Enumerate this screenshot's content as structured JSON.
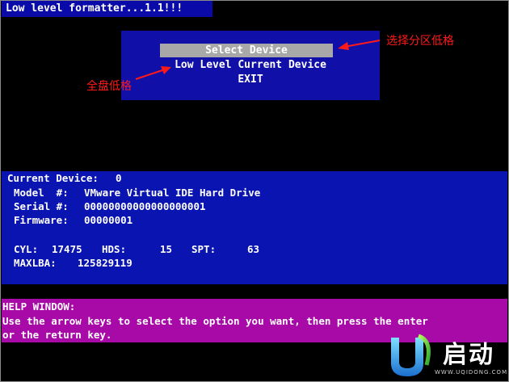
{
  "title": "Low level formatter...1.1!!!",
  "menu": {
    "items": [
      {
        "label": "Select Device",
        "selected": true
      },
      {
        "label": "Low Level Current Device",
        "selected": false
      },
      {
        "label": "EXIT",
        "selected": false
      }
    ]
  },
  "annotations": {
    "partition_format": "选择分区低格",
    "full_disk_format": "全盘低格",
    "color": "#ff1a1a"
  },
  "device": {
    "current_device_label": "Current Device:",
    "current_device_value": "0",
    "model_label": "Model  #:",
    "model_value": "VMware Virtual IDE Hard Drive",
    "serial_label": "Serial #:",
    "serial_value": "00000000000000000001",
    "firmware_label": "Firmware:",
    "firmware_value": "00000001",
    "cyl_label": "CYL:",
    "cyl_value": "17475",
    "hds_label": "HDS:",
    "hds_value": "15",
    "spt_label": "SPT:",
    "spt_value": "63",
    "maxlba_label": "MAXLBA:",
    "maxlba_value": "125829119"
  },
  "help": {
    "title": "HELP WINDOW:",
    "line1": "Use the arrow keys to select the option you want, then press the enter",
    "line2": "or the return key."
  },
  "logo": {
    "text": "启动",
    "url": "WWW.UQIDONG.COM"
  },
  "colors": {
    "background": "#000000",
    "title_bar": "#0a0aa8",
    "menu_bg": "#1010a8",
    "menu_selected": "#a8a8a8",
    "info_bg": "#0a14b0",
    "help_bg": "#a80aa8"
  }
}
